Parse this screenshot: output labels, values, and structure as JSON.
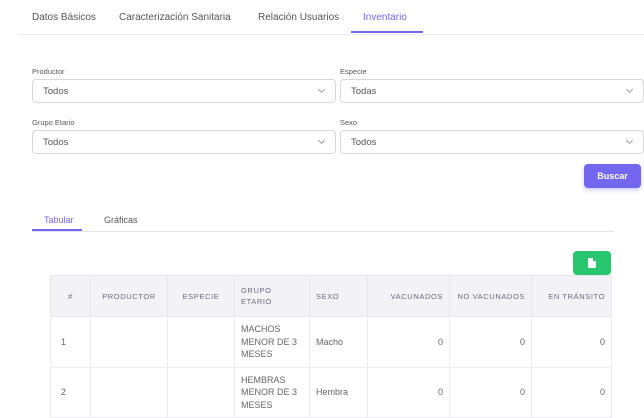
{
  "top_tabs": [
    {
      "label": "Datos Básicos",
      "active": false
    },
    {
      "label": "Caracterización Sanitaria",
      "active": false
    },
    {
      "label": "Relación Usuarios",
      "active": false
    },
    {
      "label": "Inventario",
      "active": true
    }
  ],
  "filters": {
    "productor": {
      "label": "Productor",
      "value": "Todos"
    },
    "especie": {
      "label": "Especie",
      "value": "Todas"
    },
    "grupo_etario": {
      "label": "Grupo Etario",
      "value": "Todos"
    },
    "sexo": {
      "label": "Sexo",
      "value": "Todos"
    },
    "search_button": "Buscar"
  },
  "view_tabs": [
    {
      "label": "Tabular",
      "active": true
    },
    {
      "label": "Gráficas",
      "active": false
    }
  ],
  "table": {
    "headers": [
      "#",
      "PRODUCTOR",
      "ESPECIE",
      "GRUPO ETARIO",
      "SEXO",
      "VACUNADOS",
      "NO VACUNADOS",
      "EN TRÁNSITO"
    ],
    "rows": [
      {
        "num": "1",
        "productor": "",
        "especie": "",
        "grupo": "MACHOS MENOR DE 3 MESES",
        "sexo": "Macho",
        "vacunados": "0",
        "no_vacunados": "0",
        "en_transito": "0"
      },
      {
        "num": "2",
        "productor": "",
        "especie": "",
        "grupo": "HEMBRAS MENOR DE 3 MESES",
        "sexo": "Hembra",
        "vacunados": "0",
        "no_vacunados": "0",
        "en_transito": "0"
      }
    ]
  },
  "colors": {
    "primary": "#7367f0",
    "success": "#28c76f",
    "header_bg": "#f3f2f7"
  }
}
